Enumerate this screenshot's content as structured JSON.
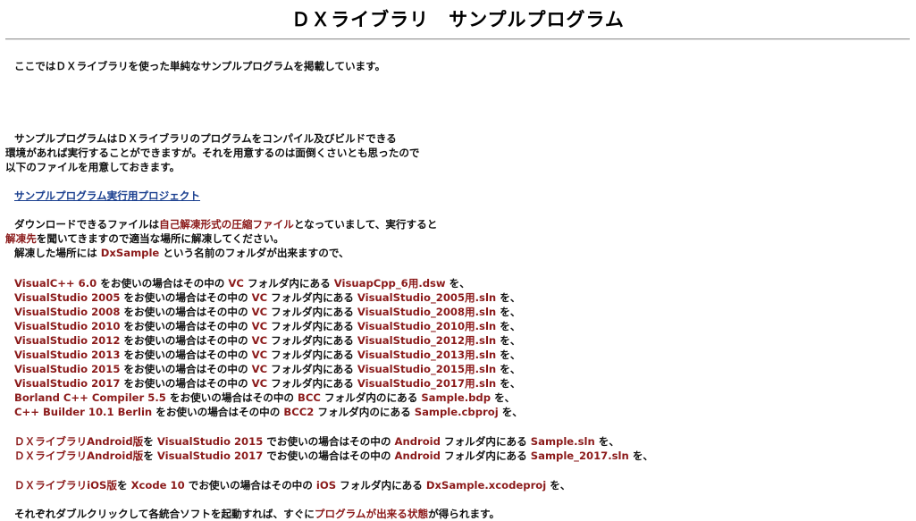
{
  "title": "ＤＸライブラリ　サンプルプログラム",
  "intro": "ここではＤＸライブラリを使った単純なサンプルプログラムを掲載しています。",
  "para1": {
    "line1": "サンプルプログラムはＤＸライブラリのプログラムをコンパイル及びビルドできる",
    "line2": "環境があれば実行することができますが。それを用意するのは面倒くさいとも思ったので",
    "line3": "以下のファイルを用意しておきます。"
  },
  "project_link": "サンプルプログラム実行用プロジェクト",
  "para2": {
    "l1a": "ダウンロードできるファイルは",
    "l1b": "自己解凍形式の圧縮ファイル",
    "l1c": "となっていまして、実行すると",
    "l2a": "解凍先",
    "l2b": "を聞いてきますので適当な場所に解凍してください。",
    "l3a": "解凍した場所には ",
    "l3b": "DxSample",
    "l3c": " という名前のフォルダが出来ますので、"
  },
  "rows": [
    {
      "a": "VisualC++ 6.0",
      "b": " をお使いの場合はその中の ",
      "c": "VC",
      "d": " フォルダ内にある ",
      "e": "VisuapCpp_6用.dsw",
      "f": " を、"
    },
    {
      "a": "VisualStudio 2005",
      "b": " をお使いの場合はその中の ",
      "c": "VC",
      "d": " フォルダ内にある ",
      "e": "VisualStudio_2005用.sln",
      "f": " を、"
    },
    {
      "a": "VisualStudio 2008",
      "b": " をお使いの場合はその中の ",
      "c": "VC",
      "d": " フォルダ内にある ",
      "e": "VisualStudio_2008用.sln",
      "f": " を、"
    },
    {
      "a": "VisualStudio 2010",
      "b": " をお使いの場合はその中の ",
      "c": "VC",
      "d": " フォルダ内にある ",
      "e": "VisualStudio_2010用.sln",
      "f": " を、"
    },
    {
      "a": "VisualStudio 2012",
      "b": " をお使いの場合はその中の ",
      "c": "VC",
      "d": " フォルダ内にある ",
      "e": "VisualStudio_2012用.sln",
      "f": " を、"
    },
    {
      "a": "VisualStudio 2013",
      "b": " をお使いの場合はその中の ",
      "c": "VC",
      "d": " フォルダ内にある ",
      "e": "VisualStudio_2013用.sln",
      "f": " を、"
    },
    {
      "a": "VisualStudio 2015",
      "b": " をお使いの場合はその中の ",
      "c": "VC",
      "d": " フォルダ内にある ",
      "e": "VisualStudio_2015用.sln",
      "f": " を、"
    },
    {
      "a": "VisualStudio 2017",
      "b": " をお使いの場合はその中の ",
      "c": "VC",
      "d": " フォルダ内にある ",
      "e": "VisualStudio_2017用.sln",
      "f": " を、"
    },
    {
      "a": "Borland C++ Compiler 5.5",
      "b": " をお使いの場合はその中の ",
      "c": "BCC",
      "d": " フォルダ内のにある ",
      "e": "Sample.bdp",
      "f": " を、"
    },
    {
      "a": "C++ Builder 10.1 Berlin",
      "b": " をお使いの場合はその中の ",
      "c": "BCC2",
      "d": " フォルダ内のにある ",
      "e": "Sample.cbproj",
      "f": " を、"
    }
  ],
  "android_rows": [
    {
      "a": "ＤＸライブラリAndroid版",
      "b": "を ",
      "c": "VisualStudio 2015",
      "d": " でお使いの場合はその中の ",
      "e": "Android",
      "f": " フォルダ内にある ",
      "g": "Sample.sln",
      "h": " を、"
    },
    {
      "a": "ＤＸライブラリAndroid版",
      "b": "を ",
      "c": "VisualStudio 2017",
      "d": " でお使いの場合はその中の ",
      "e": "Android",
      "f": " フォルダ内にある ",
      "g": "Sample_2017.sln",
      "h": " を、"
    }
  ],
  "ios_row": {
    "a": "ＤＸライブラリiOS版",
    "b": "を ",
    "c": "Xcode 10",
    "d": " でお使いの場合はその中の ",
    "e": "iOS",
    "f": " フォルダ内にある ",
    "g": "DxSample.xcodeproj",
    "h": " を、"
  },
  "final": {
    "a": "それぞれダブルクリックして各統合ソフトを起動すれば、すぐに",
    "b": "プログラムが出来る状態",
    "c": "が得られます。"
  },
  "colors": {
    "highlight": "#8b1a1a",
    "link": "#1a3f8f",
    "text": "#111111"
  }
}
